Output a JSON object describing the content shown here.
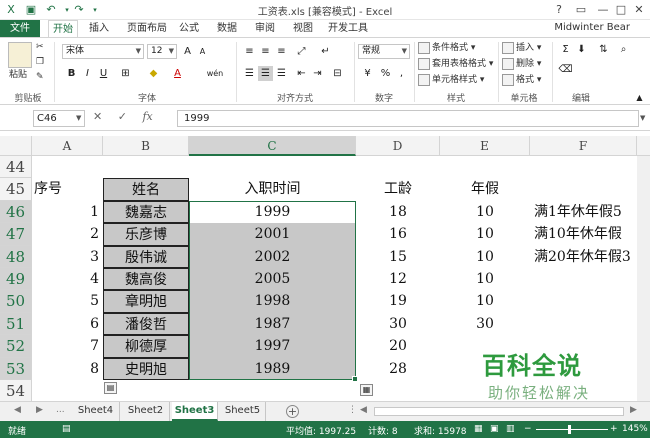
{
  "window": {
    "title": "工资表.xls  [兼容模式] - Excel",
    "user": "Midwinter Bear",
    "help_label": "?",
    "controls": {
      "restore_ribbon": "▭",
      "minimize": "—",
      "maximize": "□",
      "close": "✕"
    }
  },
  "ribbon": {
    "tabs": [
      "文件",
      "开始",
      "插入",
      "页面布局",
      "公式",
      "数据",
      "审阅",
      "视图",
      "开发工具"
    ],
    "clipboard": {
      "paste": "粘贴",
      "label": "剪贴板"
    },
    "font": {
      "name": "宋体",
      "size": "12",
      "bold": "B",
      "italic": "I",
      "underline": "U",
      "grow": "A",
      "shrink": "A",
      "color": "A",
      "phonetic": "wén",
      "label": "字体"
    },
    "alignment": {
      "label": "对齐方式"
    },
    "number": {
      "format": "常规",
      "percent": "%",
      "comma": ",",
      "label": "数字"
    },
    "styles": {
      "conditional": "条件格式",
      "table": "套用表格格式",
      "cell": "单元格样式",
      "label": "样式"
    },
    "cells": {
      "insert": "插入",
      "delete": "删除",
      "format": "格式",
      "label": "单元格"
    },
    "editing": {
      "label": "编辑"
    }
  },
  "formula_bar": {
    "name_box": "C46",
    "fx": "fx",
    "cancel": "✕",
    "confirm": "✓",
    "value": "1999"
  },
  "grid": {
    "columns": [
      "A",
      "B",
      "C",
      "D",
      "E",
      "F"
    ],
    "selected_column": "C",
    "rows": [
      "44",
      "45",
      "46",
      "47",
      "48",
      "49",
      "50",
      "51",
      "52",
      "53",
      "54"
    ],
    "headers": {
      "A": "序号",
      "B": "姓名",
      "C": "入职时间",
      "D": "工龄",
      "E": "年假"
    },
    "records": [
      {
        "no": "1",
        "name": "魏嘉志",
        "date": "1999",
        "years": "18",
        "leave": "10"
      },
      {
        "no": "2",
        "name": "乐彦博",
        "date": "2001",
        "years": "16",
        "leave": "10"
      },
      {
        "no": "3",
        "name": "殷伟诚",
        "date": "2002",
        "years": "15",
        "leave": "10"
      },
      {
        "no": "4",
        "name": "魏高俊",
        "date": "2005",
        "years": "12",
        "leave": "10"
      },
      {
        "no": "5",
        "name": "章明旭",
        "date": "1998",
        "years": "19",
        "leave": "10"
      },
      {
        "no": "6",
        "name": "潘俊哲",
        "date": "1987",
        "years": "30",
        "leave": "30"
      },
      {
        "no": "7",
        "name": "柳德厚",
        "date": "1997",
        "years": "20",
        "leave": ""
      },
      {
        "no": "8",
        "name": "史明旭",
        "date": "1989",
        "years": "28",
        "leave": ""
      }
    ],
    "notes": [
      "满1年休年假5",
      "满10年休年假",
      "满20年休年假3"
    ]
  },
  "sheets": {
    "nav_more": "...",
    "tabs": [
      "Sheet4",
      "Sheet2",
      "Sheet3",
      "Sheet5"
    ],
    "active": "Sheet3",
    "add": "+"
  },
  "status": {
    "ready": "就绪",
    "average": "平均值: 1997.25",
    "count": "计数: 8",
    "sum": "求和: 15978",
    "zoom": "145%"
  },
  "watermark": {
    "title": "百科全说",
    "subtitle": "助你轻松解决"
  },
  "colors": {
    "accent": "#217346",
    "selection_fill": "#c8c8c8",
    "watermark": "#2e9a3e"
  }
}
